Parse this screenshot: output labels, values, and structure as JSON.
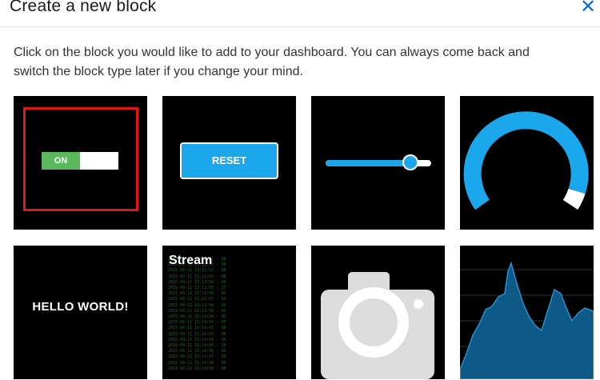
{
  "dialog": {
    "title": "Create a new block",
    "close_glyph": "✕",
    "intro_line1": "Click on the block you would like to add to your dashboard. You can always come back and",
    "intro_line2": "switch the block type later if you change your mind."
  },
  "blocks": {
    "toggle": {
      "on_label": "ON",
      "selected": true,
      "accent": "#5cb85c",
      "selection_color": "#e0161b"
    },
    "momentary": {
      "label": "RESET",
      "accent": "#1aa7ec"
    },
    "slider": {
      "value_fraction": 0.8,
      "accent": "#1aa7ec"
    },
    "gauge": {
      "value_fraction": 0.8,
      "accent": "#1aa7ec"
    },
    "text": {
      "label": "HELLO WORLD!"
    },
    "stream": {
      "title": "Stream",
      "line_color": "#1f6b2a"
    },
    "image": {
      "icon": "camera-icon"
    },
    "line_chart": {
      "fill": "#0c5a85"
    }
  }
}
